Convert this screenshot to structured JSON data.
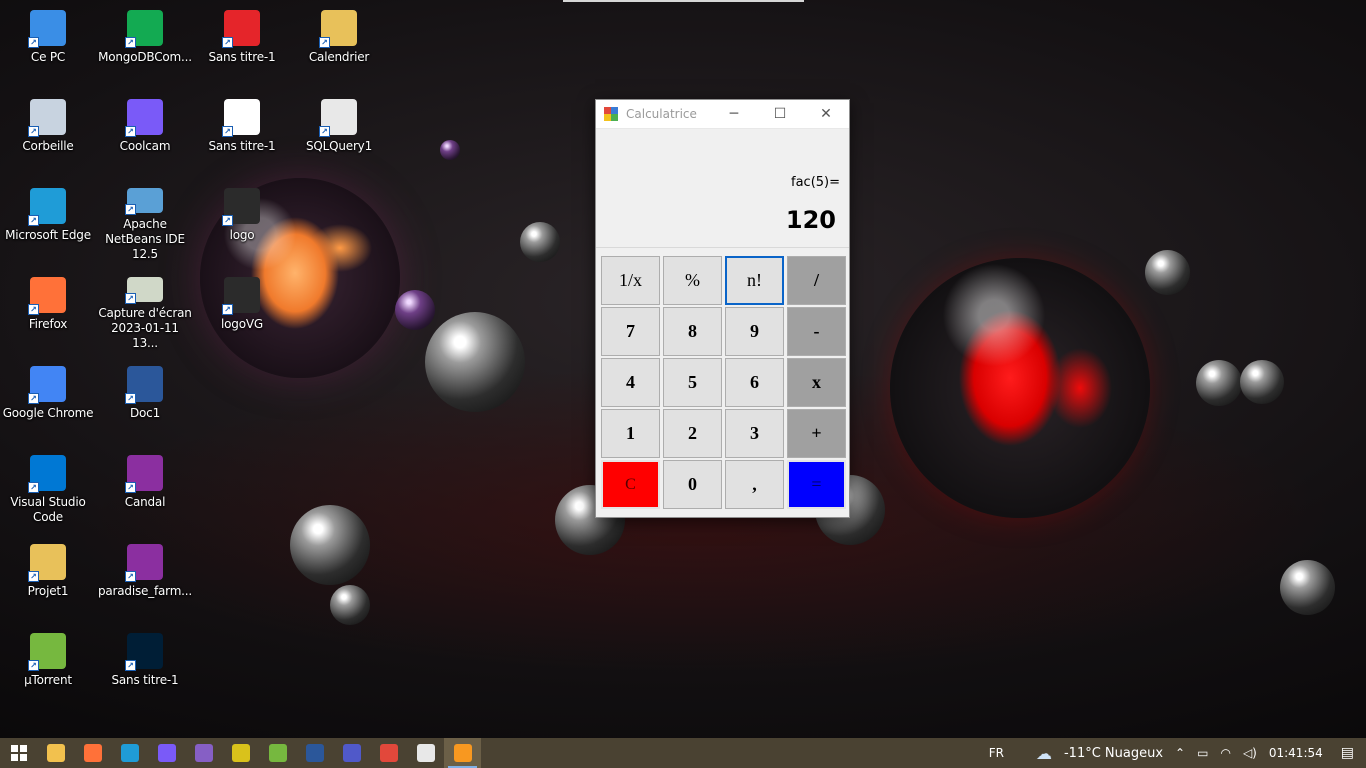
{
  "desktop": {
    "icons": [
      {
        "label": "Ce PC",
        "icon": "computer-icon",
        "color": "#3a8ee6"
      },
      {
        "label": "MongoDBCom...",
        "icon": "mongodb-icon",
        "color": "#13aa52"
      },
      {
        "label": "Sans titre-1",
        "icon": "pdf-icon",
        "color": "#e5252a"
      },
      {
        "label": "Calendrier",
        "icon": "folder-icon",
        "color": "#e8c15a"
      },
      {
        "label": "Corbeille",
        "icon": "recycle-bin-icon",
        "color": "#c8d3e0"
      },
      {
        "label": "Coolcam",
        "icon": "coolcam-icon",
        "color": "#7a5af8"
      },
      {
        "label": "Sans titre-1",
        "icon": "image-file-icon",
        "color": "#ffffff"
      },
      {
        "label": "SQLQuery1",
        "icon": "sql-file-icon",
        "color": "#e8e8e8"
      },
      {
        "label": "Microsoft Edge",
        "icon": "edge-icon",
        "color": "#1f9cd7"
      },
      {
        "label": "Apache NetBeans IDE 12.5",
        "icon": "netbeans-icon",
        "color": "#5aa0d6"
      },
      {
        "label": "logo",
        "icon": "image-file-icon",
        "color": "#2b2b2b"
      },
      {
        "label": "Firefox",
        "icon": "firefox-icon",
        "color": "#ff7139"
      },
      {
        "label": "Capture d'écran 2023-01-11 13...",
        "icon": "screenshot-icon",
        "color": "#d0d8c8"
      },
      {
        "label": "logoVG",
        "icon": "image-file-icon",
        "color": "#2b2b2b"
      },
      {
        "label": "Google Chrome",
        "icon": "chrome-icon",
        "color": "#4285f4"
      },
      {
        "label": "Doc1",
        "icon": "word-icon",
        "color": "#2b579a"
      },
      {
        "label": "Visual Studio Code",
        "icon": "vscode-icon",
        "color": "#0078d4"
      },
      {
        "label": "Candal",
        "icon": "winrar-icon",
        "color": "#8b2fa0"
      },
      {
        "label": "Projet1",
        "icon": "folder-icon",
        "color": "#e8c15a"
      },
      {
        "label": "paradise_farm...",
        "icon": "winrar-icon",
        "color": "#8b2fa0"
      },
      {
        "label": "µTorrent",
        "icon": "utorrent-icon",
        "color": "#76b83f"
      },
      {
        "label": "Sans titre-1",
        "icon": "photoshop-icon",
        "color": "#001e36"
      }
    ]
  },
  "calculator": {
    "title": "Calculatrice",
    "minimize": "─",
    "maximize": "☐",
    "close": "✕",
    "expression": "fac(5)=",
    "result": "120",
    "keys": [
      {
        "label": "1/x",
        "name": "reciprocal-button",
        "kind": "fn"
      },
      {
        "label": "%",
        "name": "percent-button",
        "kind": "fn"
      },
      {
        "label": "n!",
        "name": "factorial-button",
        "kind": "focus"
      },
      {
        "label": "/",
        "name": "divide-button",
        "kind": "op"
      },
      {
        "label": "7",
        "name": "digit-7-button",
        "kind": "digit"
      },
      {
        "label": "8",
        "name": "digit-8-button",
        "kind": "digit"
      },
      {
        "label": "9",
        "name": "digit-9-button",
        "kind": "digit"
      },
      {
        "label": "-",
        "name": "subtract-button",
        "kind": "op"
      },
      {
        "label": "4",
        "name": "digit-4-button",
        "kind": "digit"
      },
      {
        "label": "5",
        "name": "digit-5-button",
        "kind": "digit"
      },
      {
        "label": "6",
        "name": "digit-6-button",
        "kind": "digit"
      },
      {
        "label": "x",
        "name": "multiply-button",
        "kind": "op"
      },
      {
        "label": "1",
        "name": "digit-1-button",
        "kind": "digit"
      },
      {
        "label": "2",
        "name": "digit-2-button",
        "kind": "digit"
      },
      {
        "label": "3",
        "name": "digit-3-button",
        "kind": "digit"
      },
      {
        "label": "+",
        "name": "add-button",
        "kind": "op"
      },
      {
        "label": "C",
        "name": "clear-button",
        "kind": "clear"
      },
      {
        "label": "0",
        "name": "digit-0-button",
        "kind": "digit"
      },
      {
        "label": ",",
        "name": "decimal-button",
        "kind": "digit"
      },
      {
        "label": "=",
        "name": "equals-button",
        "kind": "equal"
      }
    ],
    "colors": {
      "clear": "#ff0000",
      "equal": "#0000ff",
      "operator": "#a0a0a0",
      "focus": "#0a64c8"
    }
  },
  "taskbar": {
    "apps": [
      {
        "name": "start-button",
        "icon": "windows-icon",
        "color": "#ffffff"
      },
      {
        "name": "file-explorer",
        "icon": "folder-icon",
        "color": "#f2c14e"
      },
      {
        "name": "firefox",
        "icon": "firefox-icon",
        "color": "#ff7139"
      },
      {
        "name": "edge",
        "icon": "edge-icon",
        "color": "#1f9cd7"
      },
      {
        "name": "coolcam",
        "icon": "coolcam-icon",
        "color": "#7a5af8"
      },
      {
        "name": "visual-studio",
        "icon": "visual-studio-icon",
        "color": "#865fc5"
      },
      {
        "name": "sql-tool",
        "icon": "sql-icon",
        "color": "#d9c21b"
      },
      {
        "name": "utorrent",
        "icon": "utorrent-icon",
        "color": "#76b83f"
      },
      {
        "name": "word",
        "icon": "word-icon",
        "color": "#2b579a"
      },
      {
        "name": "teams",
        "icon": "teams-icon",
        "color": "#5059c9"
      },
      {
        "name": "calculator-form",
        "icon": "form-icon",
        "color": "#e2483b"
      },
      {
        "name": "paint",
        "icon": "paint-icon",
        "color": "#e8e8e8"
      },
      {
        "name": "java-app",
        "icon": "java-icon",
        "color": "#f89820",
        "active": true
      }
    ],
    "language": "FR",
    "weather": "-11°C  Nuageux",
    "clock": "01:41:54"
  }
}
